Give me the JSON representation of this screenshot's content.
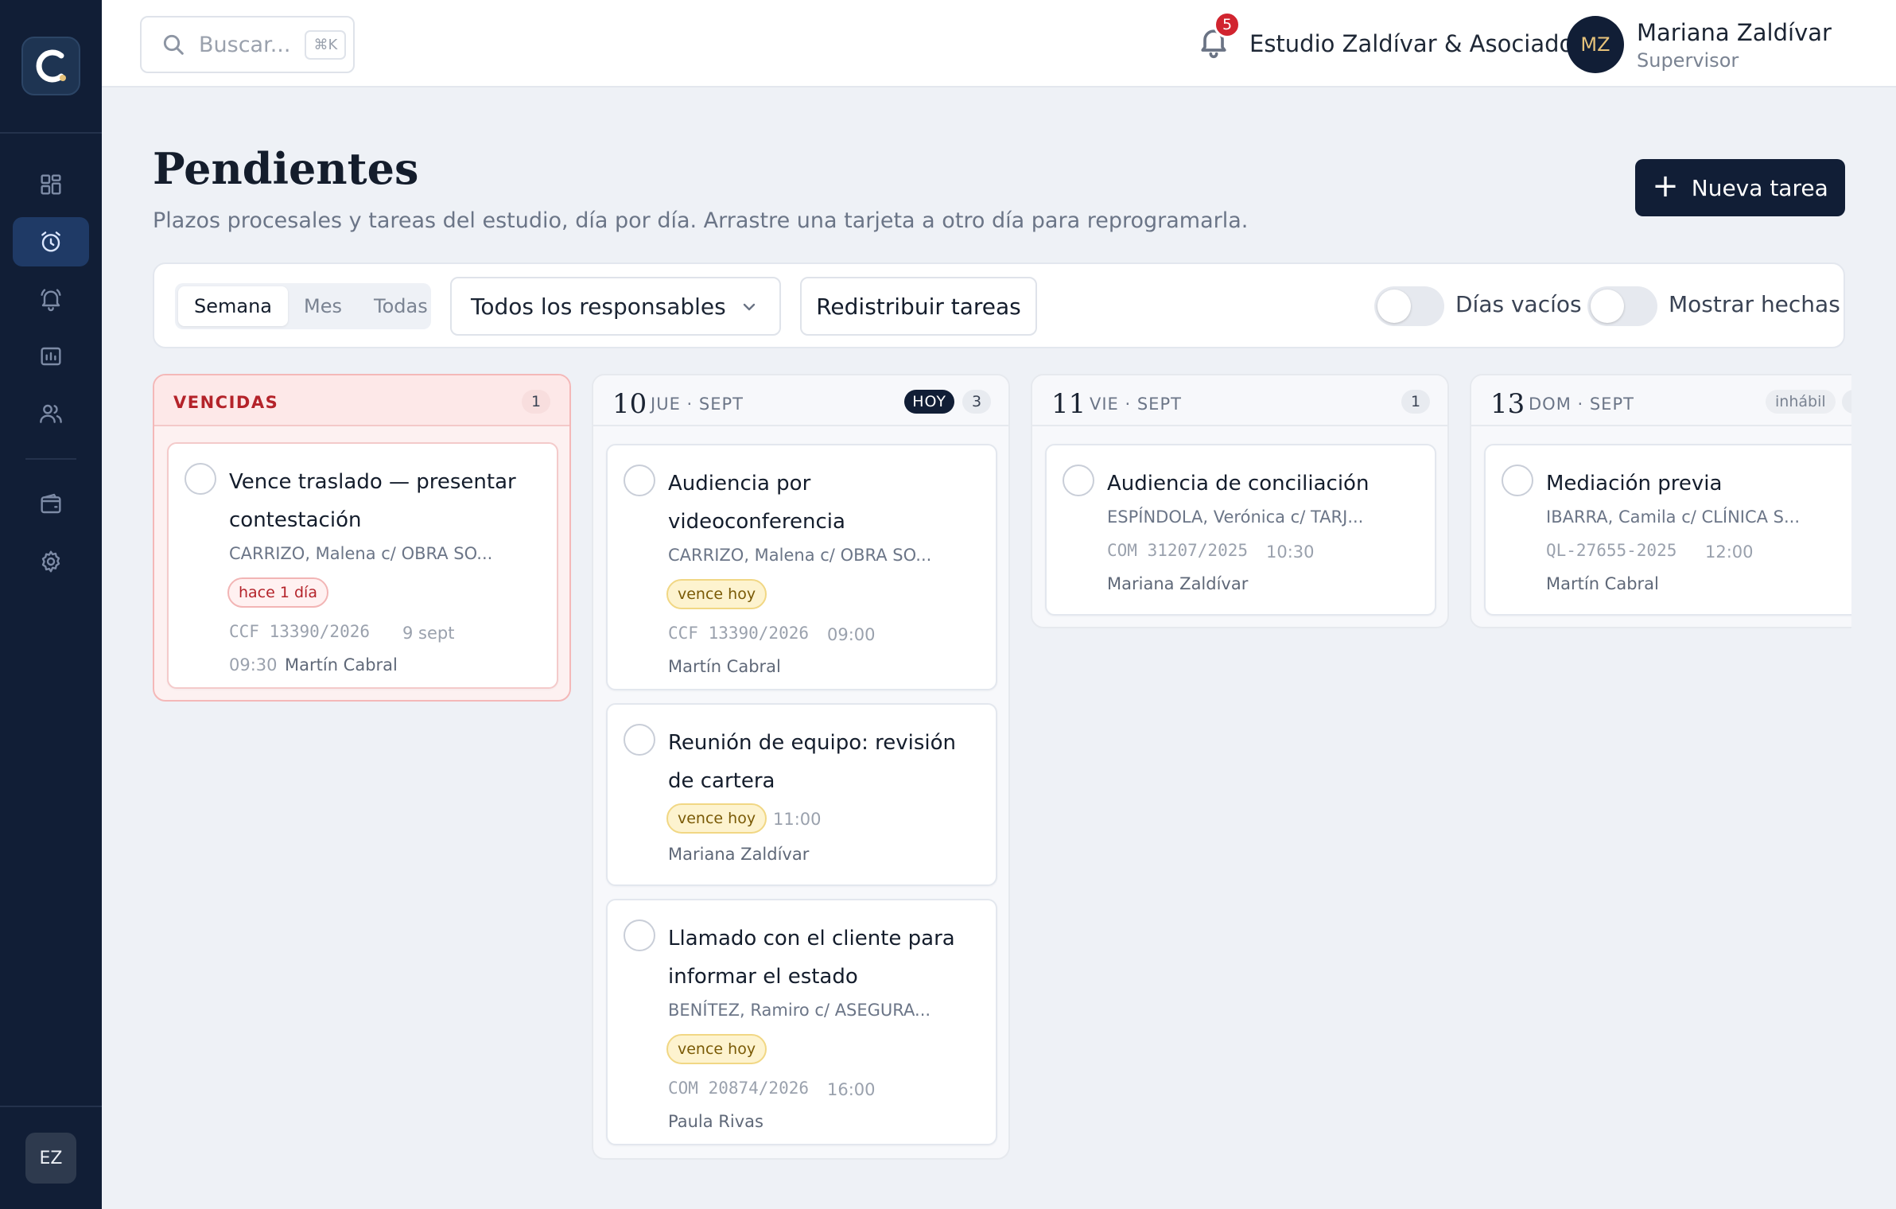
{
  "sidebar": {
    "logo_letter": "C",
    "nav": [
      {
        "name": "dashboard",
        "icon": "grid-icon",
        "active": false
      },
      {
        "name": "pendientes",
        "icon": "alarm-clock-icon",
        "active": true
      },
      {
        "name": "alertas",
        "icon": "bell-ring-icon",
        "active": false
      },
      {
        "name": "expedientes",
        "icon": "folder-chart-icon",
        "active": false
      },
      {
        "name": "clientes",
        "icon": "users-icon",
        "active": false
      },
      {
        "name": "billetera",
        "icon": "wallet-icon",
        "active": false
      },
      {
        "name": "configuracion",
        "icon": "gear-icon",
        "active": false
      }
    ],
    "user_initials": "EZ"
  },
  "topbar": {
    "search_placeholder": "Buscar...",
    "search_shortcut": "⌘K",
    "notifications_count": "5",
    "org_name": "Estudio Zaldívar & Asociados",
    "user_initials": "MZ",
    "user_name": "Mariana Zaldívar",
    "user_role": "Supervisor"
  },
  "header": {
    "title": "Pendientes",
    "subtitle": "Plazos procesales y tareas del estudio, día por día. Arrastre una tarjeta a otro día para reprogramarla.",
    "new_task_label": "Nueva tarea"
  },
  "filters": {
    "view_options": [
      "Semana",
      "Mes",
      "Todas"
    ],
    "active_view": "Semana",
    "assignee_select": "Todos los responsables",
    "redistribute_label": "Redistribuir tareas",
    "toggle_empty_days": {
      "label": "Días vacíos",
      "on": false
    },
    "toggle_show_done": {
      "label": "Mostrar hechas",
      "on": false
    }
  },
  "columns": [
    {
      "title": "VENCIDAS",
      "count": "1",
      "cards": [
        {
          "title": "Vence traslado — presentar contestación",
          "party": "CARRIZO, Malena c/ OBRA SO...",
          "tag": "hace 1 día",
          "case": "CCF 13390/2026",
          "date": "9 sept",
          "time": "09:30",
          "owner": "Martín Cabral"
        }
      ]
    },
    {
      "day": "10",
      "weekday": "JUE · SEPT",
      "today_badge": "HOY",
      "count": "3",
      "cards": [
        {
          "title": "Audiencia por videoconferencia",
          "party": "CARRIZO, Malena c/ OBRA SO...",
          "tag": "vence hoy",
          "case": "CCF 13390/2026",
          "time": "09:00",
          "owner": "Martín Cabral"
        },
        {
          "title": "Reunión de equipo: revisión de cartera",
          "tag": "vence hoy",
          "time": "11:00",
          "owner": "Mariana Zaldívar"
        },
        {
          "title": "Llamado con el cliente para informar el estado",
          "party": "BENÍTEZ, Ramiro c/ ASEGURA...",
          "tag": "vence hoy",
          "case": "COM 20874/2026",
          "time": "16:00",
          "owner": "Paula Rivas"
        }
      ]
    },
    {
      "day": "11",
      "weekday": "VIE · SEPT",
      "count": "1",
      "cards": [
        {
          "title": "Audiencia de conciliación",
          "party": "ESPÍNDOLA, Verónica c/ TARJ...",
          "case": "COM 31207/2025",
          "time": "10:30",
          "owner": "Mariana Zaldívar"
        }
      ]
    },
    {
      "day": "13",
      "weekday": "DOM · SEPT",
      "non_working_badge": "inhábil",
      "cards": [
        {
          "title": "Mediación previa",
          "party": "IBARRA, Camila c/ CLÍNICA S...",
          "case": "QL-27655-2025",
          "time": "12:00",
          "owner": "Martín Cabral"
        }
      ]
    }
  ]
}
